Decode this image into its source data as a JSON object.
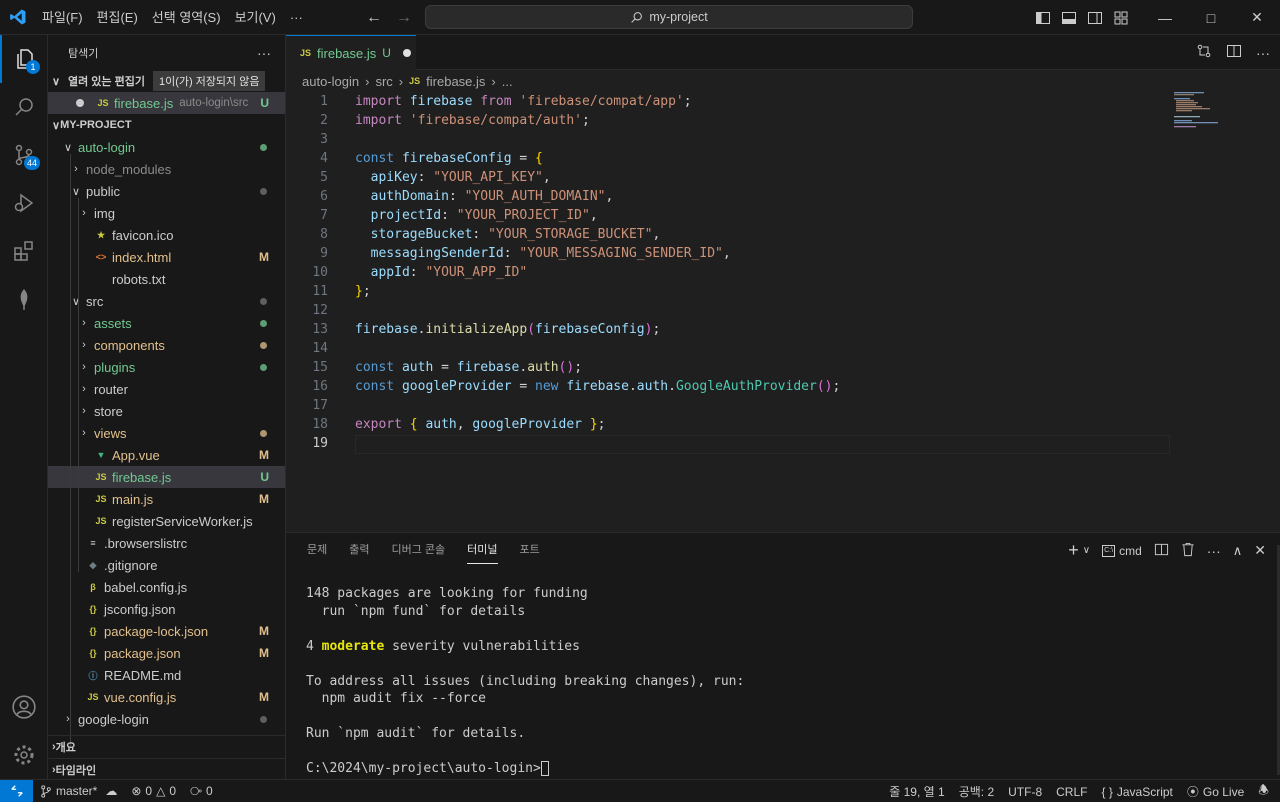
{
  "menu": [
    "파일(F)",
    "편집(E)",
    "선택 영역(S)",
    "보기(V)",
    "···"
  ],
  "command_center": "my-project",
  "activity": {
    "explorer_badge": "1",
    "scm_badge": "44"
  },
  "sidebar": {
    "title": "탐색기",
    "open_editors": {
      "label": "열려 있는 편집기",
      "tooltip": "1이(가) 저장되지 않음",
      "file": {
        "name": "firebase.js",
        "path": "auto-login\\src",
        "status": "U"
      }
    },
    "project": "MY-PROJECT",
    "tree": [
      {
        "label": "auto-login",
        "status": ""
      },
      {
        "label": "node_modules",
        "status": ""
      },
      {
        "label": "public",
        "status": ""
      },
      {
        "label": "img",
        "status": ""
      },
      {
        "label": "favicon.ico",
        "status": ""
      },
      {
        "label": "index.html",
        "status": "M"
      },
      {
        "label": "robots.txt",
        "status": ""
      },
      {
        "label": "src",
        "status": ""
      },
      {
        "label": "assets",
        "status": ""
      },
      {
        "label": "components",
        "status": ""
      },
      {
        "label": "plugins",
        "status": ""
      },
      {
        "label": "router",
        "status": ""
      },
      {
        "label": "store",
        "status": ""
      },
      {
        "label": "views",
        "status": ""
      },
      {
        "label": "App.vue",
        "status": "M"
      },
      {
        "label": "firebase.js",
        "status": "U"
      },
      {
        "label": "main.js",
        "status": "M"
      },
      {
        "label": "registerServiceWorker.js",
        "status": ""
      },
      {
        "label": ".browserslistrc",
        "status": ""
      },
      {
        "label": ".gitignore",
        "status": ""
      },
      {
        "label": "babel.config.js",
        "status": ""
      },
      {
        "label": "jsconfig.json",
        "status": ""
      },
      {
        "label": "package-lock.json",
        "status": "M"
      },
      {
        "label": "package.json",
        "status": "M"
      },
      {
        "label": "README.md",
        "status": ""
      },
      {
        "label": "vue.config.js",
        "status": "M"
      },
      {
        "label": "google-login",
        "status": ""
      }
    ],
    "outline": "개요",
    "timeline": "타임라인"
  },
  "editor": {
    "tab": {
      "name": "firebase.js",
      "status": "U"
    },
    "breadcrumb": [
      "auto-login",
      "src",
      "firebase.js",
      "..."
    ],
    "line_numbers": [
      "1",
      "2",
      "3",
      "4",
      "5",
      "6",
      "7",
      "8",
      "9",
      "10",
      "11",
      "12",
      "13",
      "14",
      "15",
      "16",
      "17",
      "18",
      "19"
    ],
    "code": [
      "import firebase from 'firebase/compat/app';",
      "import 'firebase/compat/auth';",
      "",
      "const firebaseConfig = {",
      "  apiKey: \"YOUR_API_KEY\",",
      "  authDomain: \"YOUR_AUTH_DOMAIN\",",
      "  projectId: \"YOUR_PROJECT_ID\",",
      "  storageBucket: \"YOUR_STORAGE_BUCKET\",",
      "  messagingSenderId: \"YOUR_MESSAGING_SENDER_ID\",",
      "  appId: \"YOUR_APP_ID\"",
      "};",
      "",
      "firebase.initializeApp(firebaseConfig);",
      "",
      "const auth = firebase.auth();",
      "const googleProvider = new firebase.auth.GoogleAuthProvider();",
      "",
      "export { auth, googleProvider };",
      ""
    ]
  },
  "panel": {
    "tabs": [
      "문제",
      "출력",
      "디버그 콘솔",
      "터미널",
      "포트"
    ],
    "active_tab": "터미널",
    "shell": "cmd",
    "terminal": {
      "funding1": "148 packages are looking for funding",
      "funding2": "  run `npm fund` for details",
      "vuln_count": "4 ",
      "vuln_word": "moderate",
      "vuln_rest": " severity vulnerabilities",
      "address1": "To address all issues (including breaking changes), run:",
      "address2": "  npm audit fix --force",
      "audit": "Run `npm audit` for details.",
      "prompt": "C:\\2024\\my-project\\auto-login>"
    }
  },
  "status": {
    "branch": "master*",
    "errors": "0",
    "warnings": "0",
    "ports": "0",
    "position": "줄 19, 열 1",
    "spaces": "공백: 2",
    "encoding": "UTF-8",
    "eol": "CRLF",
    "language": "JavaScript",
    "golive": "Go Live"
  },
  "colors": {
    "accent": "#0078d4",
    "modified": "#e2c08d",
    "untracked": "#73c991"
  }
}
